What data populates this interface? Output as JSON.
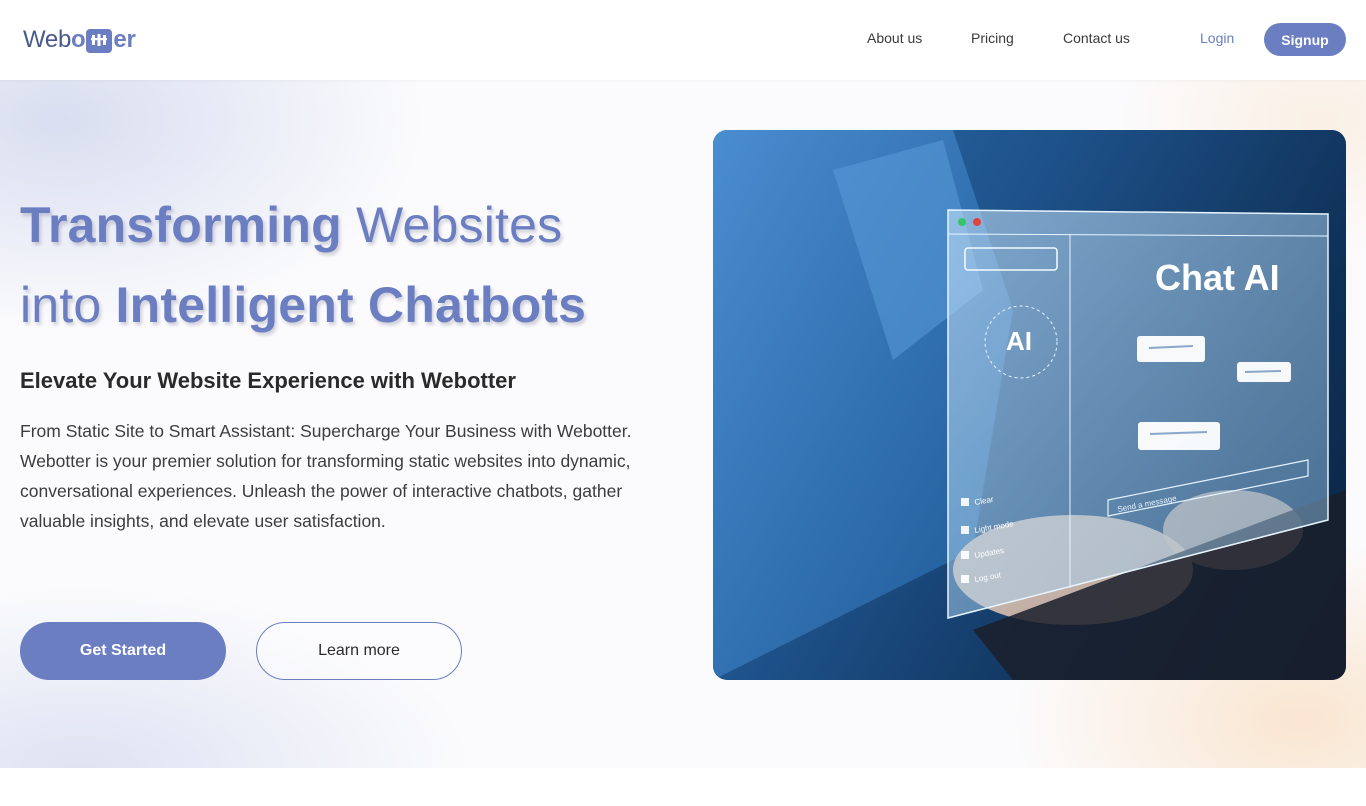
{
  "brand": {
    "logo_prefix": "Web",
    "logo_suffix": "er",
    "logo_text": "Webotter",
    "accent_color": "#6b7ec2"
  },
  "nav": {
    "about": "About us",
    "pricing": "Pricing",
    "contact": "Contact us",
    "login": "Login",
    "signup": "Signup"
  },
  "hero": {
    "headline": {
      "part1": "Transforming",
      "part2": "Websites",
      "part3": "into",
      "part4": "Intelligent Chatbots"
    },
    "subheading": "Elevate Your Website Experience with Webotter",
    "paragraph": "From Static Site to Smart Assistant: Supercharge Your Business with Webotter. Webotter is your premier solution for transforming static websites into dynamic, conversational experiences. Unleash the power of interactive chatbots, gather valuable insights, and elevate user satisfaction.",
    "primary_button": "Get Started",
    "secondary_button": "Learn more"
  },
  "hero_image": {
    "screen_title": "Chat AI",
    "ai_label": "AI",
    "menu_items": [
      "Clear",
      "Light mode",
      "Updates",
      "Log out"
    ],
    "input_placeholder": "Send a message"
  }
}
